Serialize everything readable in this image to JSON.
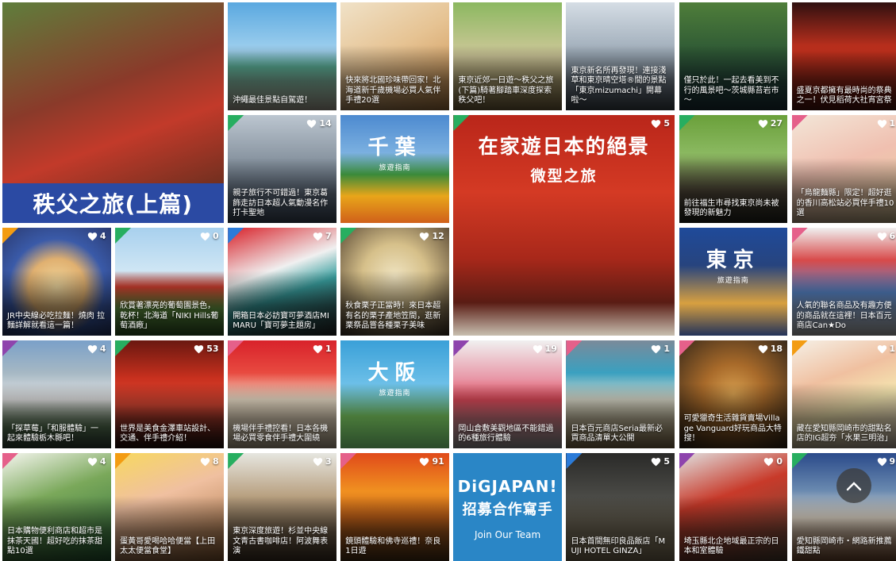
{
  "tiles": [
    {
      "caption": "",
      "likes": "",
      "category": "",
      "bg": "linear-gradient(160deg,#5f7e3c 0%,#8a3a2a 40%,#c23a2a 60%,#4a2a1a 100%)"
    },
    {
      "caption": "沖繩最佳景點自駕遊！",
      "likes": "",
      "category": "",
      "bg": "linear-gradient(180deg,#5aa8e0 0%,#9fd0ee 45%,#5fb89e 60%,#d9d4c0 100%)"
    },
    {
      "caption": "快來將北國珍味帶回家！北海道新千歲機場必買人氣伴手禮20選",
      "likes": "",
      "category": "",
      "bg": "linear-gradient(150deg,#f0e2c8 0%,#e6c393 45%,#c98d4a 100%)"
    },
    {
      "caption": "東京近郊一日遊～秩父之旅(下篇)騎著腳踏車深度探索秩父吧！",
      "likes": "",
      "category": "",
      "bg": "linear-gradient(180deg,#8bb860 0%,#cfc89a 50%,#8f7a4a 100%)"
    },
    {
      "caption": "東京新名所再發現！連接淺草和東京晴空塔®間的景點「東京mizumachi」開幕啦～",
      "likes": "",
      "category": "",
      "bg": "linear-gradient(180deg,#d5dde5 0%,#9aa8b5 50%,#4a5560 100%)"
    },
    {
      "caption": "僅只於此！一起去看美到不行的風景吧～茨城縣苔岩市～",
      "likes": "",
      "category": "",
      "bg": "linear-gradient(180deg,#4f7e3a 0%,#2f5a35 45%,#1f3a44 100%)"
    },
    {
      "caption": "盛夏京都擁有最時尚的祭典之一！伏見稻荷大社宵宮祭",
      "likes": "",
      "category": "",
      "bg": "linear-gradient(180deg,#301010 0%,#c8321e 45%,#5a1810 100%)"
    },
    {
      "caption": "親子旅行不可錯過！東京葛飾走訪日本超人氣動漫名作打卡聖地",
      "likes": "14",
      "category": "photo",
      "bg": "linear-gradient(180deg,#bcc6d0 0%,#8a96a2 40%,#4a5a70 100%)"
    },
    {
      "caption": "",
      "likes": "",
      "category": "",
      "bg": "linear-gradient(180deg,#4d8ad0 0%,#7bb0e0 35%,#3a8a3a 55%,#e8a51a 75%,#d0601a 100%)"
    },
    {
      "caption": "",
      "likes": "5",
      "category": "photo",
      "bg": "linear-gradient(180deg,#b9261a 0%,#d43a24 35%,#a8281a 65%,#5a1c14 85%,#c8bfb0 100%)"
    },
    {
      "caption": "前往福生市尋找東京尚未被發現的新魅力",
      "likes": "27",
      "category": "photo",
      "bg": "linear-gradient(180deg,#6aa03a 0%,#8ab860 35%,#5a5040 70%,#2a2a22 100%)"
    },
    {
      "caption": "「烏龍麵縣」限定！超好逛的香川高松站必買伴手禮10選",
      "likes": "1",
      "category": "shop",
      "bg": "linear-gradient(160deg,#f3e6d8 0%,#f0c0b0 45%,#e8d2a0 100%)"
    },
    {
      "caption": "JR中央線必吃拉麵！燒肉 拉麵詳解就看這一篇！",
      "likes": "4",
      "category": "food",
      "bg": "radial-gradient(circle at 50% 55%,#f1d9a0 0%,#e0b070 35%,#3a5aa8 60%,#2a3a70 100%)"
    },
    {
      "caption": "欣賞著漂亮的葡萄園景色，乾杯！北海道「NIKI Hills葡萄酒廠」",
      "likes": "0",
      "category": "photo",
      "bg": "linear-gradient(180deg,#a8d0ee 0%,#cfe6f4 40%,#d84030 55%,#6aa045 75%,#3a6a2a 100%)"
    },
    {
      "caption": "開箱日本必訪寶可夢酒店MIMARU「寶可夢主題房」",
      "likes": "7",
      "category": "hotel",
      "bg": "linear-gradient(160deg,#d8222a 0%,#f0f0f0 40%,#3aa0a0 60%,#2a2a2a 100%)"
    },
    {
      "caption": "秋食栗子正當時！來日本超有名的栗子產地笠間，逛新栗祭品嘗各種栗子美味",
      "likes": "12",
      "category": "photo",
      "bg": "radial-gradient(circle at 50% 45%,#efe3c0 0%,#d6c08a 40%,#4a3a2a 100%)"
    },
    {
      "caption": "",
      "likes": "",
      "category": "",
      "bg": "linear-gradient(180deg,#1f4a9a 0%,#27447e 35%,#d8a040 70%,#22325a 100%)"
    },
    {
      "caption": "人氣的聯名商品及有趣方便的商品就在這裡！日本百元商店Can★Do",
      "likes": "6",
      "category": "shop",
      "bg": "linear-gradient(180deg,#f0f0f0 0%,#d84a4a 30%,#5a8ad0 60%,#e6e6e6 100%)"
    },
    {
      "caption": "「探草莓」「和服體驗」一起來體驗栃木縣吧！",
      "likes": "4",
      "category": "play",
      "bg": "linear-gradient(180deg,#7aa0c8 0%,#a6b8c4 30%,#e8e8e8 55%,#5f7f5a 80%,#3a5040 100%)"
    },
    {
      "caption": "世界是美食金澤車站設計、交通、伴手禮介紹！",
      "likes": "53",
      "category": "photo",
      "bg": "linear-gradient(180deg,#6a1810 0%,#c8301e 35%,#e04a36 60%,#2a1410 100%)"
    },
    {
      "caption": "機場伴手禮控看！日本各機場必買零食伴手禮大圍繞",
      "likes": "1",
      "category": "shop",
      "bg": "linear-gradient(180deg,#d8222a 0%,#e84a40 30%,#f4e6d0 55%,#e2d0b0 100%)"
    },
    {
      "caption": "",
      "likes": "",
      "category": "",
      "bg": "linear-gradient(180deg,#3aa0d8 0%,#6cbfe8 40%,#4a7a3a 70%,#2a4a2a 100%)"
    },
    {
      "caption": "岡山倉敷美觀地區不能錯過的6種旅行體驗",
      "likes": "19",
      "category": "play",
      "bg": "linear-gradient(180deg,#f0f0f0 0%,#e898a8 35%,#e04a5a 55%,#c0c0c0 100%)"
    },
    {
      "caption": "日本百元商店Seria最新必買商品清單大公開",
      "likes": "1",
      "category": "shop",
      "bg": "linear-gradient(180deg,#7a8a9a 0%,#3aa0c0 30%,#e0e0d0 55%,#a0885a 100%)"
    },
    {
      "caption": "可愛獵奇生活雜貨賣場Village Vanguard好玩商品大特搜！",
      "likes": "18",
      "category": "shop",
      "bg": "radial-gradient(circle at 50% 50%,#d8a050 0%,#a86a2a 40%,#3a2a1a 100%)"
    },
    {
      "caption": "藏在愛知縣岡崎市的甜點名店的IG超夯「水果三明治」",
      "likes": "1",
      "category": "food",
      "bg": "linear-gradient(160deg,#f5f0e6 0%,#f0c0a0 35%,#f5e6b0 60%,#e0d0c0 100%)"
    },
    {
      "caption": "日本購物便利商店和超市是抹茶天國！超好吃的抹茶甜點10選",
      "likes": "4",
      "category": "shop",
      "bg": "linear-gradient(160deg,#f6f6f0 0%,#7aa85a 40%,#2a6a3a 100%)"
    },
    {
      "caption": "蛋黃哥愛喝哈哈便當【上田太太便當食堂】",
      "likes": "8",
      "category": "food",
      "bg": "linear-gradient(160deg,#f7d860 0%,#f0c0a0 40%,#a06a3a 100%)"
    },
    {
      "caption": "東京深度旅遊！杉並中央線文青古書咖啡店！阿波舞表演",
      "likes": "3",
      "category": "photo",
      "bg": "linear-gradient(180deg,#e6e6e0 0%,#b8a080 40%,#4a3a2a 100%)"
    },
    {
      "caption": "鏡頭體驗和佛寺巡禮！奈良1日遊",
      "likes": "91",
      "category": "event",
      "bg": "linear-gradient(180deg,#e04a1a 0%,#f09020 35%,#c8641a 60%,#5a3a1a 100%)"
    },
    {
      "caption": "",
      "likes": "",
      "category": "",
      "bg": "#2a86c6"
    },
    {
      "caption": "日本首間無印良品飯店「MUJI HOTEL GINZA」",
      "likes": "5",
      "category": "hotel",
      "bg": "linear-gradient(180deg,#2a2a28 0%,#4a4a46 40%,#9a8a6a 100%)"
    },
    {
      "caption": "埼玉縣北企地域最正宗的日本和室體驗",
      "likes": "0",
      "category": "play",
      "bg": "linear-gradient(160deg,#e0e0e0 0%,#c83a2a 40%,#5a4a3a 100%)"
    },
    {
      "caption": "愛知縣岡崎市・網路新推薦鐵甜點",
      "likes": "9",
      "category": "photo",
      "bg": "linear-gradient(180deg,#2a4a8a 0%,#6a8ab0 35%,#f0e6d6 60%,#8a5a3a 100%)"
    }
  ],
  "chichibu_title": "秩父之旅(上篇)",
  "feature": {
    "line1": "在家遊日本的絕景",
    "line2": "微型之旅"
  },
  "chiba": {
    "name": "千葉",
    "sub": "旅遊指南"
  },
  "tokyo": {
    "name": "東京",
    "sub": "旅遊指南"
  },
  "osaka": {
    "name": "大阪",
    "sub": "旅遊指南"
  },
  "recruit": {
    "line1": "DiGJAPAN!",
    "line2": "招募合作寫手",
    "line3": "Join Our Team"
  },
  "icons": {
    "like": "heart-icon",
    "scroll": "chevron-up-icon"
  }
}
